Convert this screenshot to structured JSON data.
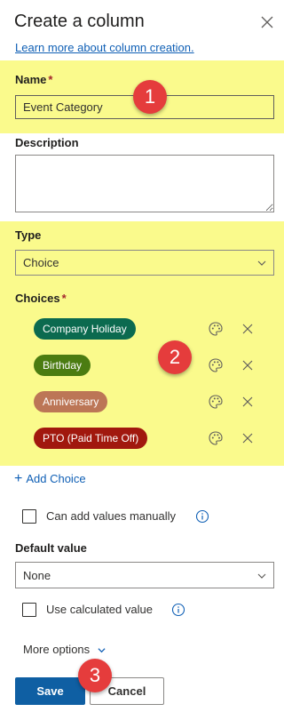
{
  "panel": {
    "title": "Create a column",
    "learn_more": "Learn more about column creation."
  },
  "name": {
    "label": "Name",
    "required_mark": "*",
    "value": "Event Category"
  },
  "description": {
    "label": "Description",
    "value": ""
  },
  "type": {
    "label": "Type",
    "value": "Choice"
  },
  "choices": {
    "label": "Choices",
    "required_mark": "*",
    "items": [
      {
        "label": "Company Holiday",
        "color": "#0b6a4f"
      },
      {
        "label": "Birthday",
        "color": "#4b7c11"
      },
      {
        "label": "Anniversary",
        "color": "#bc7656"
      },
      {
        "label": "PTO (Paid Time Off)",
        "color": "#a1180e"
      }
    ],
    "add_label": "Add Choice"
  },
  "options": {
    "manual_values_label": "Can add values manually",
    "manual_values_checked": false,
    "calculated_label": "Use calculated value",
    "calculated_checked": false
  },
  "default_value": {
    "label": "Default value",
    "value": "None"
  },
  "more_options_label": "More options",
  "buttons": {
    "save": "Save",
    "cancel": "Cancel"
  },
  "annotations": [
    "1",
    "2",
    "3"
  ],
  "colors": {
    "highlight": "#fafa8c",
    "link": "#0f5fb5",
    "primary_button": "#0f5fa3",
    "badge": "#e53c3c"
  },
  "icons": {
    "close": "close-icon",
    "chevron": "chevron-down-icon",
    "palette": "palette-icon",
    "remove": "close-icon",
    "info": "info-icon",
    "add": "plus-icon"
  }
}
